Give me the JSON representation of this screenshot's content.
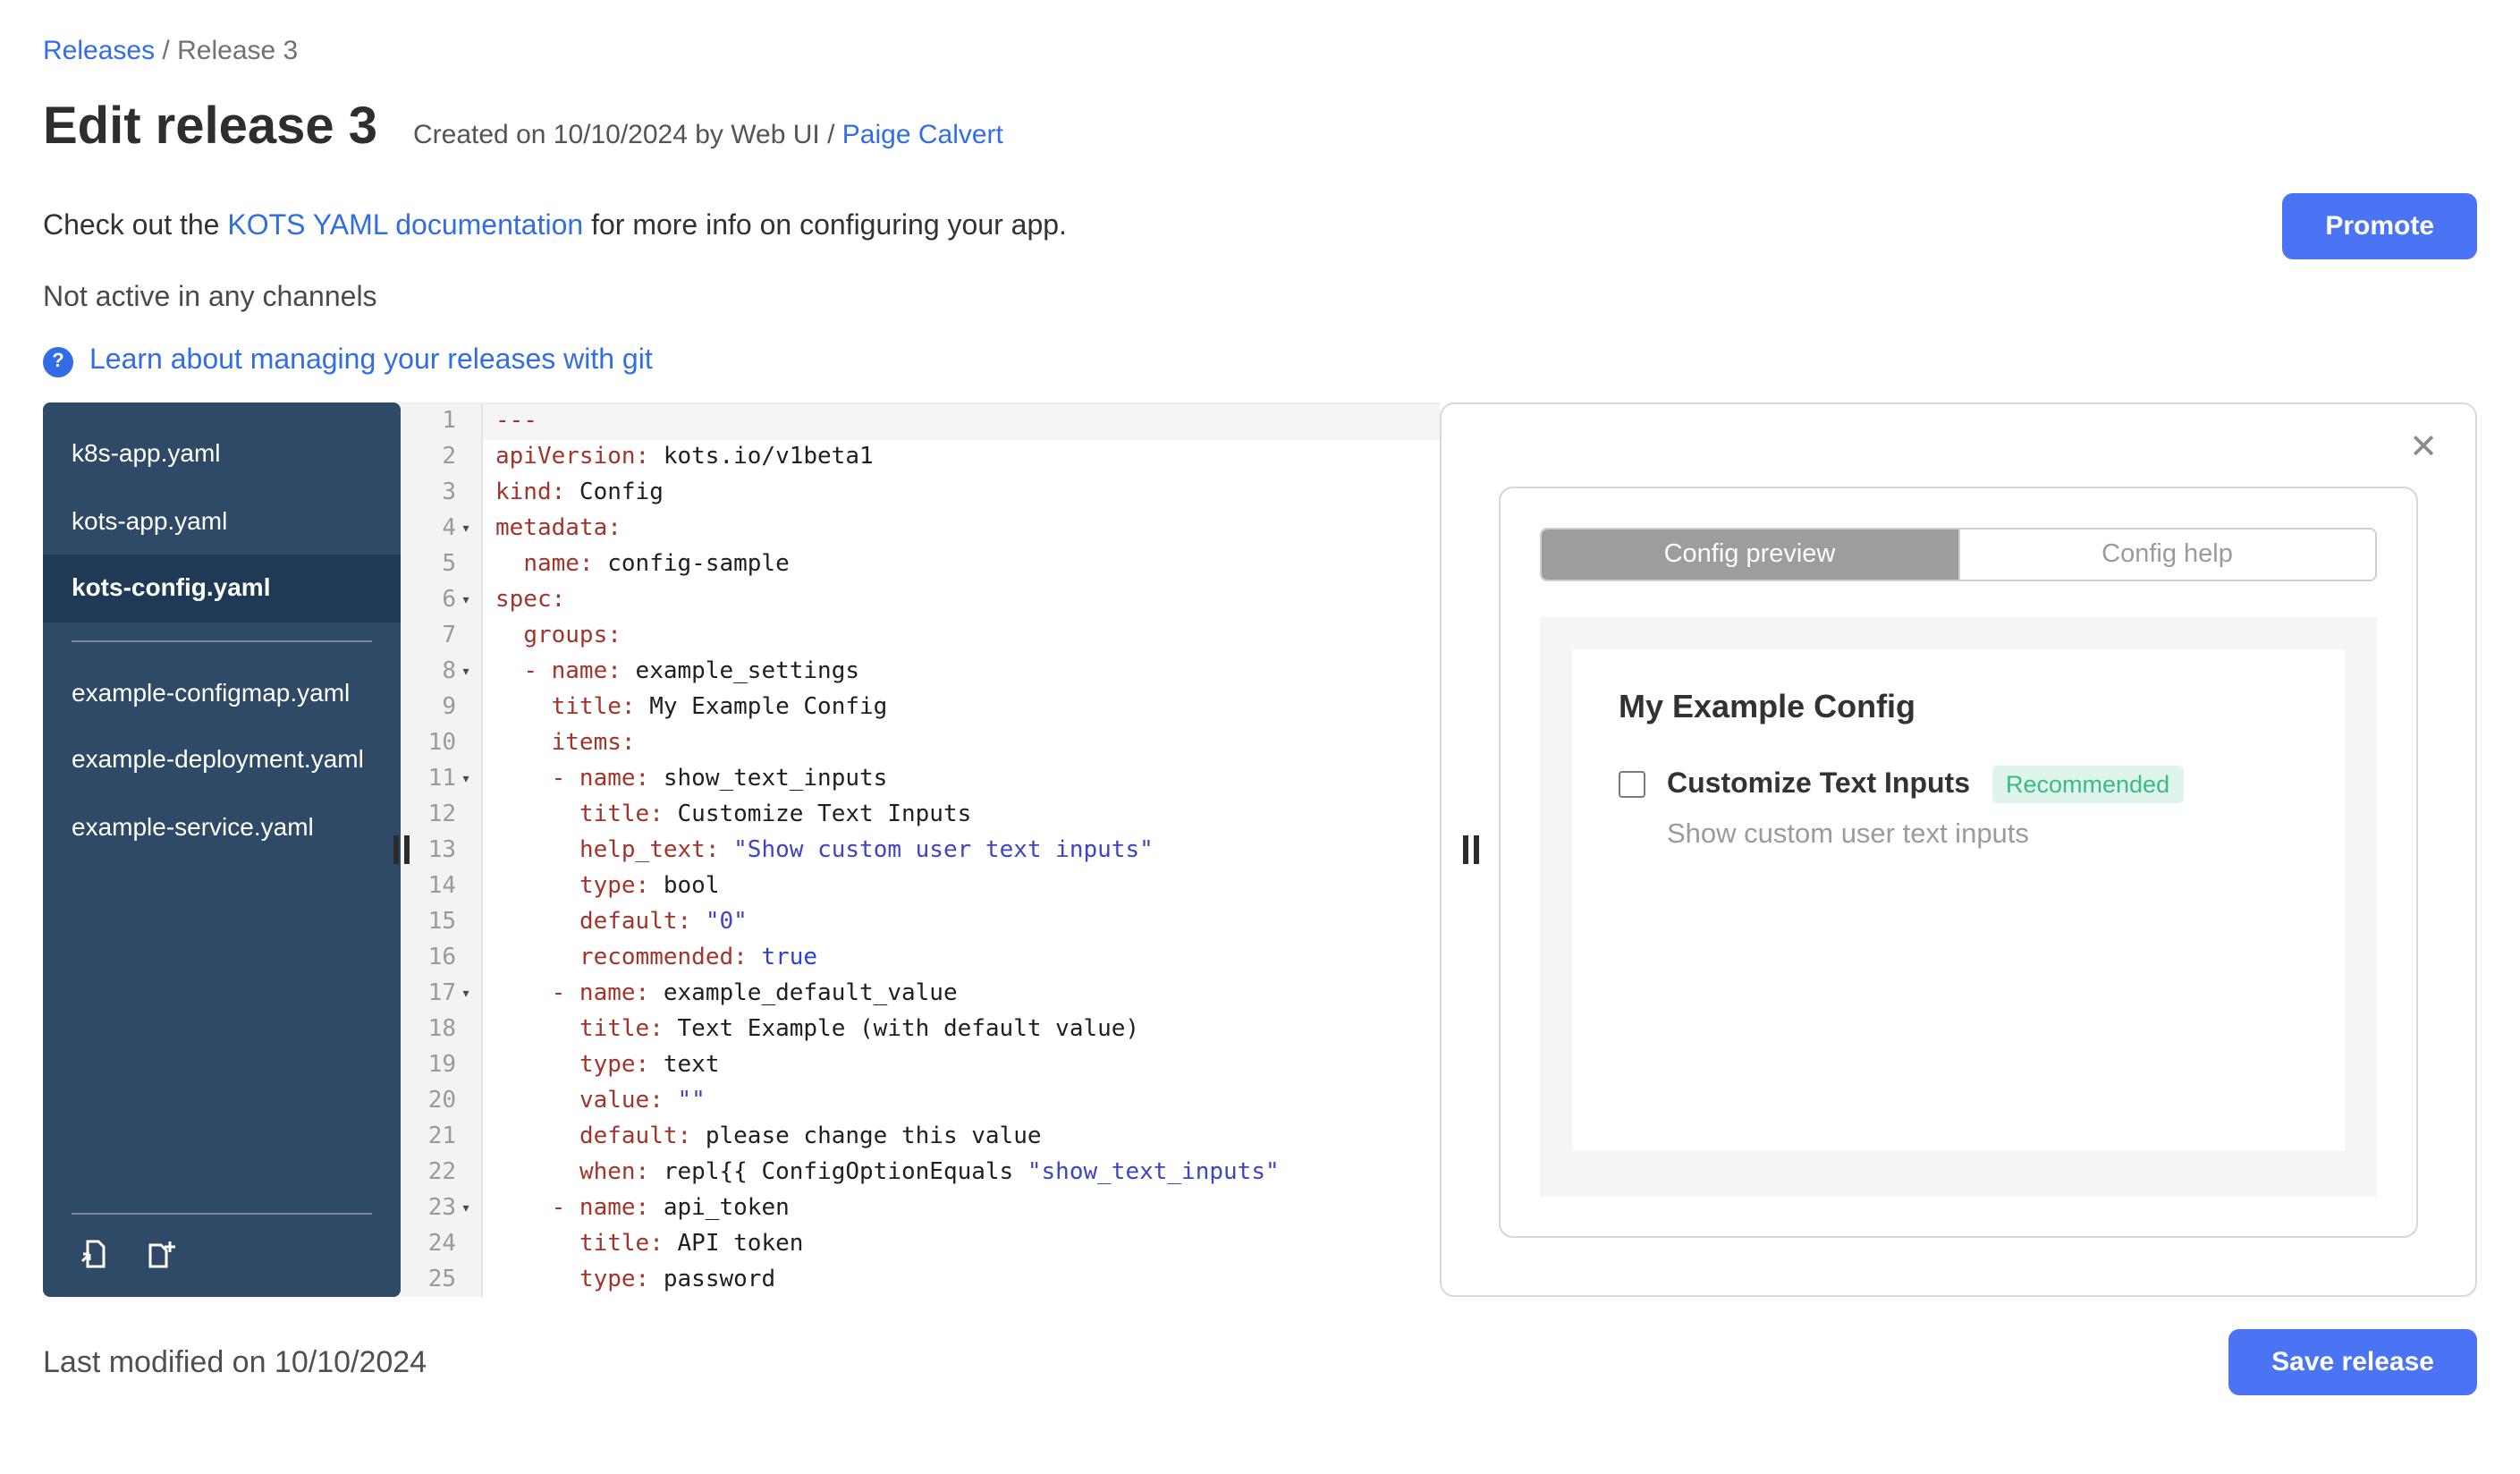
{
  "colors": {
    "button_blue": "#4A74F4",
    "link_blue": "#326DE6",
    "sidebar_bg": "#2E4A66",
    "badge_green_bg": "#DFF5EC",
    "badge_green_text": "#3BBB84",
    "yaml_key_red": "#A1352C",
    "yaml_string_blue": "#3F44C0"
  },
  "icons": {
    "close": "✕",
    "help_question": "?",
    "fold_arrow": "▾"
  },
  "breadcrumb": {
    "link": "Releases",
    "separator": " / ",
    "current": "Release 3"
  },
  "header": {
    "title": "Edit release 3",
    "created": "Created on 10/10/2024 by Web UI / ",
    "author_link": "Paige Calvert"
  },
  "info": {
    "prefix": "Check out the ",
    "doc_link": "KOTS YAML documentation",
    "suffix": " for more info on configuring your app.",
    "status": "Not active in any channels",
    "help_link": "Learn about managing your releases with git"
  },
  "toolbar": {
    "promote_label": "Promote",
    "save_label": "Save release"
  },
  "footer": {
    "last_modified": "Last modified on 10/10/2024"
  },
  "file_tree": {
    "files": [
      {
        "label": "k8s-app.yaml",
        "active": false,
        "divider_after": false
      },
      {
        "label": "kots-app.yaml",
        "active": false,
        "divider_after": false
      },
      {
        "label": "kots-config.yaml",
        "active": true,
        "divider_after": true
      },
      {
        "label": "example-configmap.yaml",
        "active": false,
        "divider_after": false
      },
      {
        "label": "example-deployment.yaml",
        "active": false,
        "divider_after": false
      },
      {
        "label": "example-service.yaml",
        "active": false,
        "divider_after": false
      }
    ]
  },
  "editor": {
    "lines": [
      {
        "n": 1,
        "fold": false,
        "active": true,
        "tokens": [
          [
            "k",
            "---"
          ]
        ]
      },
      {
        "n": 2,
        "fold": false,
        "active": false,
        "tokens": [
          [
            "k",
            "apiVersion:"
          ],
          [
            "p",
            " kots.io/v1beta1"
          ]
        ]
      },
      {
        "n": 3,
        "fold": false,
        "active": false,
        "tokens": [
          [
            "k",
            "kind:"
          ],
          [
            "p",
            " Config"
          ]
        ]
      },
      {
        "n": 4,
        "fold": true,
        "active": false,
        "tokens": [
          [
            "k",
            "metadata:"
          ]
        ]
      },
      {
        "n": 5,
        "fold": false,
        "active": false,
        "tokens": [
          [
            "p",
            "  "
          ],
          [
            "k",
            "name:"
          ],
          [
            "p",
            " config-sample"
          ]
        ]
      },
      {
        "n": 6,
        "fold": true,
        "active": false,
        "tokens": [
          [
            "k",
            "spec:"
          ]
        ]
      },
      {
        "n": 7,
        "fold": false,
        "active": false,
        "tokens": [
          [
            "p",
            "  "
          ],
          [
            "k",
            "groups:"
          ]
        ]
      },
      {
        "n": 8,
        "fold": true,
        "active": false,
        "tokens": [
          [
            "p",
            "  "
          ],
          [
            "k",
            "- name:"
          ],
          [
            "p",
            " example_settings"
          ]
        ]
      },
      {
        "n": 9,
        "fold": false,
        "active": false,
        "tokens": [
          [
            "p",
            "    "
          ],
          [
            "k",
            "title:"
          ],
          [
            "p",
            " My Example Config"
          ]
        ]
      },
      {
        "n": 10,
        "fold": false,
        "active": false,
        "tokens": [
          [
            "p",
            "    "
          ],
          [
            "k",
            "items:"
          ]
        ]
      },
      {
        "n": 11,
        "fold": true,
        "active": false,
        "tokens": [
          [
            "p",
            "    "
          ],
          [
            "k",
            "- name:"
          ],
          [
            "p",
            " show_text_inputs"
          ]
        ]
      },
      {
        "n": 12,
        "fold": false,
        "active": false,
        "tokens": [
          [
            "p",
            "      "
          ],
          [
            "k",
            "title:"
          ],
          [
            "p",
            " Customize Text Inputs"
          ]
        ]
      },
      {
        "n": 13,
        "fold": false,
        "active": false,
        "tokens": [
          [
            "p",
            "      "
          ],
          [
            "k",
            "help_text:"
          ],
          [
            "p",
            " "
          ],
          [
            "s",
            "\"Show custom user text inputs\""
          ]
        ]
      },
      {
        "n": 14,
        "fold": false,
        "active": false,
        "tokens": [
          [
            "p",
            "      "
          ],
          [
            "k",
            "type:"
          ],
          [
            "p",
            " bool"
          ]
        ]
      },
      {
        "n": 15,
        "fold": false,
        "active": false,
        "tokens": [
          [
            "p",
            "      "
          ],
          [
            "k",
            "default:"
          ],
          [
            "p",
            " "
          ],
          [
            "s",
            "\"0\""
          ]
        ]
      },
      {
        "n": 16,
        "fold": false,
        "active": false,
        "tokens": [
          [
            "p",
            "      "
          ],
          [
            "k",
            "recommended:"
          ],
          [
            "p",
            " "
          ],
          [
            "b",
            "true"
          ]
        ]
      },
      {
        "n": 17,
        "fold": true,
        "active": false,
        "tokens": [
          [
            "p",
            "    "
          ],
          [
            "k",
            "- name:"
          ],
          [
            "p",
            " example_default_value"
          ]
        ]
      },
      {
        "n": 18,
        "fold": false,
        "active": false,
        "tokens": [
          [
            "p",
            "      "
          ],
          [
            "k",
            "title:"
          ],
          [
            "p",
            " Text Example (with default value)"
          ]
        ]
      },
      {
        "n": 19,
        "fold": false,
        "active": false,
        "tokens": [
          [
            "p",
            "      "
          ],
          [
            "k",
            "type:"
          ],
          [
            "p",
            " text"
          ]
        ]
      },
      {
        "n": 20,
        "fold": false,
        "active": false,
        "tokens": [
          [
            "p",
            "      "
          ],
          [
            "k",
            "value:"
          ],
          [
            "p",
            " "
          ],
          [
            "s",
            "\"\""
          ]
        ]
      },
      {
        "n": 21,
        "fold": false,
        "active": false,
        "tokens": [
          [
            "p",
            "      "
          ],
          [
            "k",
            "default:"
          ],
          [
            "p",
            " please change this value"
          ]
        ]
      },
      {
        "n": 22,
        "fold": false,
        "active": false,
        "tokens": [
          [
            "p",
            "      "
          ],
          [
            "k",
            "when:"
          ],
          [
            "p",
            " repl{{ ConfigOptionEquals "
          ],
          [
            "s",
            "\"show_text_inputs\""
          ]
        ]
      },
      {
        "n": 23,
        "fold": true,
        "active": false,
        "tokens": [
          [
            "p",
            "    "
          ],
          [
            "k",
            "- name:"
          ],
          [
            "p",
            " api_token"
          ]
        ]
      },
      {
        "n": 24,
        "fold": false,
        "active": false,
        "tokens": [
          [
            "p",
            "      "
          ],
          [
            "k",
            "title:"
          ],
          [
            "p",
            " API token"
          ]
        ]
      },
      {
        "n": 25,
        "fold": false,
        "active": false,
        "tokens": [
          [
            "p",
            "      "
          ],
          [
            "k",
            "type:"
          ],
          [
            "p",
            " password"
          ]
        ]
      }
    ]
  },
  "preview": {
    "tabs": [
      {
        "label": "Config preview",
        "active": true
      },
      {
        "label": "Config help",
        "active": false
      }
    ],
    "group_title": "My Example Config",
    "item_title": "Customize Text Inputs",
    "badge": "Recommended",
    "help_text": "Show custom user text inputs"
  }
}
